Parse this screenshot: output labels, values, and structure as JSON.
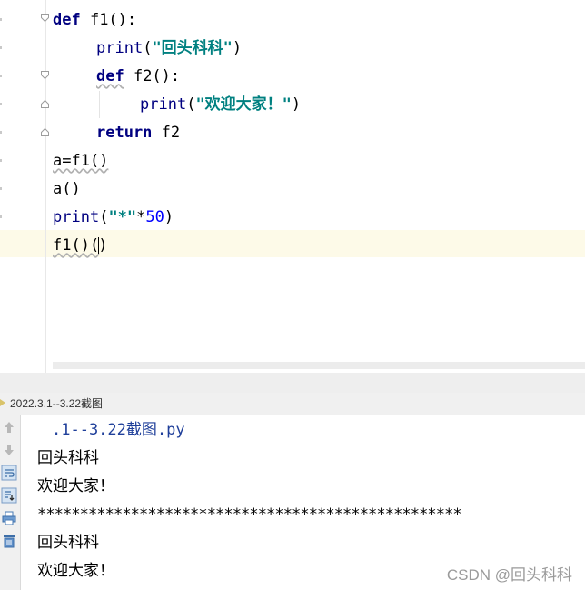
{
  "editor": {
    "lines": [
      {
        "kw": "def",
        "rest": " f1():"
      },
      {
        "fn": "print",
        "open": "(",
        "str": "\"回头科科\"",
        "close": ")"
      },
      {
        "kw": "def",
        "rest": " f2():"
      },
      {
        "fn": "print",
        "open": "(",
        "str": "\"欢迎大家！\"",
        "close": ")"
      },
      {
        "kw": "return",
        "rest": " f2"
      },
      {
        "text": "a=f1()"
      },
      {
        "text": "a()"
      },
      {
        "fn": "print",
        "open": "(",
        "str": "\"*\"",
        "rest": "*",
        "num": "50",
        "close": ")"
      },
      {
        "before_caret": "f1()(",
        "after_caret": ")"
      }
    ]
  },
  "run_panel": {
    "tab_title": "2022.3.1--3.22截图",
    "file_line": ".1--3.22截图.py",
    "output": [
      "回头科科",
      "欢迎大家！",
      "**************************************************",
      "回头科科",
      "欢迎大家！"
    ],
    "toolbar_icons": [
      "up-arrow-icon",
      "down-arrow-icon",
      "soft-wrap-icon",
      "scroll-to-end-icon",
      "print-icon",
      "trash-icon"
    ]
  },
  "watermark": "CSDN @回头科科",
  "colors": {
    "keyword": "#000080",
    "string": "#008080",
    "number": "#0000ff",
    "current_line": "#fdfae8"
  }
}
